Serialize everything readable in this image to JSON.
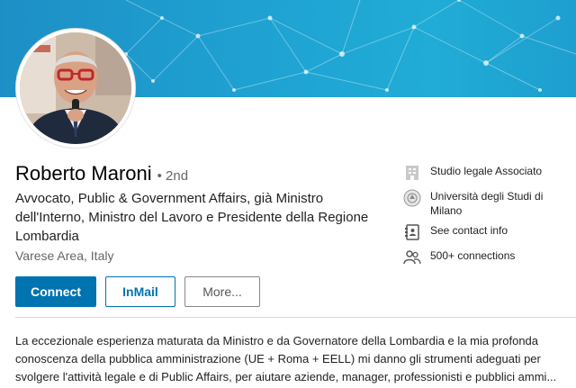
{
  "profile": {
    "name": "Roberto Maroni",
    "degree": "• 2nd",
    "headline": "Avvocato, Public & Government Affairs, già Ministro dell'Interno, Ministro del Lavoro e Presidente della Regione Lombardia",
    "location": "Varese Area, Italy"
  },
  "actions": {
    "connect_label": "Connect",
    "inmail_label": "InMail",
    "more_label": "More..."
  },
  "sidebar": {
    "company": {
      "icon": "building-icon",
      "label": "Studio legale Associato"
    },
    "school": {
      "icon": "university-logo-icon",
      "label": "Università degli Studi di Milano"
    },
    "contact": {
      "icon": "contact-card-icon",
      "label": "See contact info"
    },
    "connections": {
      "icon": "people-icon",
      "label": "500+ connections"
    }
  },
  "summary": {
    "text": "La eccezionale esperienza maturata da Ministro e da Governatore della Lombardia e la mia profonda conoscenza della pubblica amministrazione (UE + Roma + EELL) mi danno gli strumenti adeguati per svolgere l'attività legale e di Public Affairs, per aiutare aziende, manager, professionisti e pubblici ammi..."
  },
  "colors": {
    "banner": "#1fa2d2",
    "primary": "#0073b1",
    "muted_text": "#666666"
  }
}
